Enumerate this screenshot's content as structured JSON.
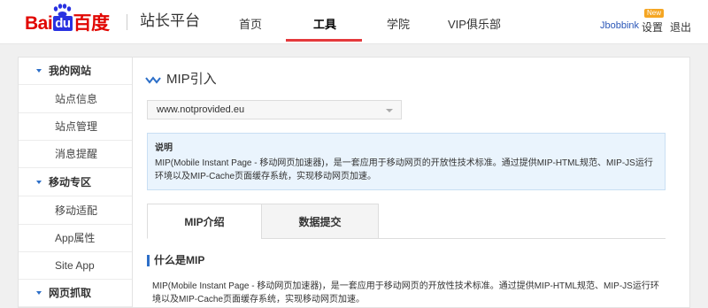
{
  "header": {
    "logo": {
      "part1": "Bai",
      "part2": "du",
      "part3": "百度"
    },
    "site_name": "站长平台",
    "nav": [
      {
        "label": "首页"
      },
      {
        "label": "工具"
      },
      {
        "label": "学院"
      },
      {
        "label": "VIP俱乐部"
      }
    ],
    "user": "Jbobbink",
    "settings": "设置",
    "new_badge": "New",
    "logout": "退出"
  },
  "sidebar": {
    "items": [
      {
        "label": "我的网站",
        "type": "group"
      },
      {
        "label": "站点信息",
        "type": "item"
      },
      {
        "label": "站点管理",
        "type": "item"
      },
      {
        "label": "消息提醒",
        "type": "item"
      },
      {
        "label": "移动专区",
        "type": "group"
      },
      {
        "label": "移动适配",
        "type": "item"
      },
      {
        "label": "App属性",
        "type": "item"
      },
      {
        "label": "Site App",
        "type": "item"
      },
      {
        "label": "网页抓取",
        "type": "group"
      }
    ]
  },
  "main": {
    "title": "MIP引入",
    "site_select": {
      "value": "www.notprovided.eu"
    },
    "notice": {
      "title": "说明",
      "text": "MIP(Mobile Instant Page - 移动网页加速器)，是一套应用于移动网页的开放性技术标准。通过提供MIP-HTML规范、MIP-JS运行环境以及MIP-Cache页面缓存系统，实现移动网页加速。"
    },
    "tabs": [
      {
        "label": "MIP介绍"
      },
      {
        "label": "数据提交"
      }
    ],
    "section": {
      "title": "什么是MIP",
      "text": "MIP(Mobile Instant Page - 移动网页加速器)，是一套应用于移动网页的开放性技术标准。通过提供MIP-HTML规范、MIP-JS运行环境以及MIP-Cache页面缓存系统，实现移动网页加速。"
    }
  },
  "colors": {
    "brand_red": "#e10601",
    "brand_blue": "#2932e1",
    "accent_blue": "#2d6fc8",
    "nav_underline": "#e4393c",
    "notice_bg": "#eaf4fd"
  }
}
